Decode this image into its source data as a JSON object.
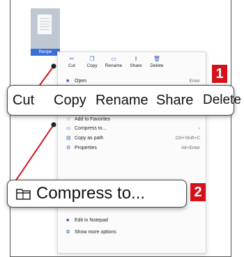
{
  "file": {
    "label": "Recipe"
  },
  "quick_actions": [
    {
      "label": "Cut",
      "icon": "scissors-icon"
    },
    {
      "label": "Copy",
      "icon": "copy-icon"
    },
    {
      "label": "Rename",
      "icon": "rename-icon"
    },
    {
      "label": "Share",
      "icon": "share-icon"
    },
    {
      "label": "Delete",
      "icon": "trash-icon"
    }
  ],
  "menu_items": [
    {
      "label": "Open",
      "shortcut": "Enter",
      "icon": "open-icon"
    },
    {
      "label": "Add to Favorites",
      "shortcut": "",
      "icon": "star-icon"
    },
    {
      "label": "Compress to...",
      "shortcut": "›",
      "icon": "zip-folder-icon"
    },
    {
      "label": "Copy as path",
      "shortcut": "Ctrl+Shift+C",
      "icon": "path-icon"
    },
    {
      "label": "Properties",
      "shortcut": "Alt+Enter",
      "icon": "wrench-icon"
    },
    {
      "label": "Edit in Notepad",
      "shortcut": "",
      "icon": "notepad-icon"
    },
    {
      "label": "Show more options",
      "shortcut": "",
      "icon": "more-options-icon"
    }
  ],
  "callout1": {
    "badge": "1",
    "labels": [
      "Cut",
      "Copy",
      "Rename",
      "Share",
      "Delete"
    ]
  },
  "callout2": {
    "badge": "2",
    "label": "Compress to..."
  },
  "colors": {
    "badge": "#d4111a",
    "accent": "#3a5fb8",
    "file_label_bg": "#3a6fd8"
  }
}
